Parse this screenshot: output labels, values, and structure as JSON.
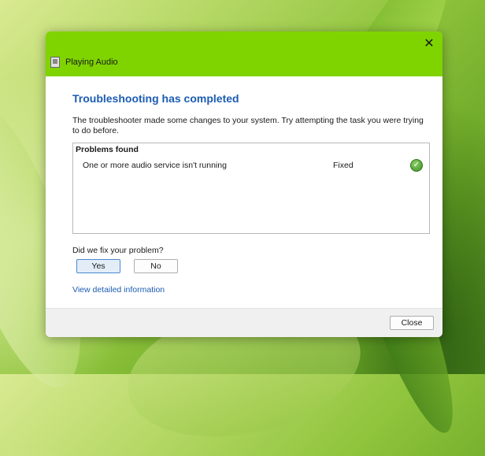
{
  "window": {
    "title": "Playing Audio",
    "close_symbol": "✕"
  },
  "main": {
    "heading": "Troubleshooting has completed",
    "description": "The troubleshooter made some changes to your system. Try attempting the task you were trying to do before.",
    "problems": {
      "header": "Problems found",
      "items": [
        {
          "name": "One or more audio service isn't running",
          "status": "Fixed",
          "icon": "green-check-icon"
        }
      ]
    },
    "question": "Did we fix your problem?",
    "yes_label": "Yes",
    "no_label": "No",
    "detail_link": "View detailed information"
  },
  "footer": {
    "close_label": "Close"
  },
  "colors": {
    "titlebar": "#7fd400",
    "heading": "#1b5cb3",
    "link": "#1b5cb3"
  }
}
